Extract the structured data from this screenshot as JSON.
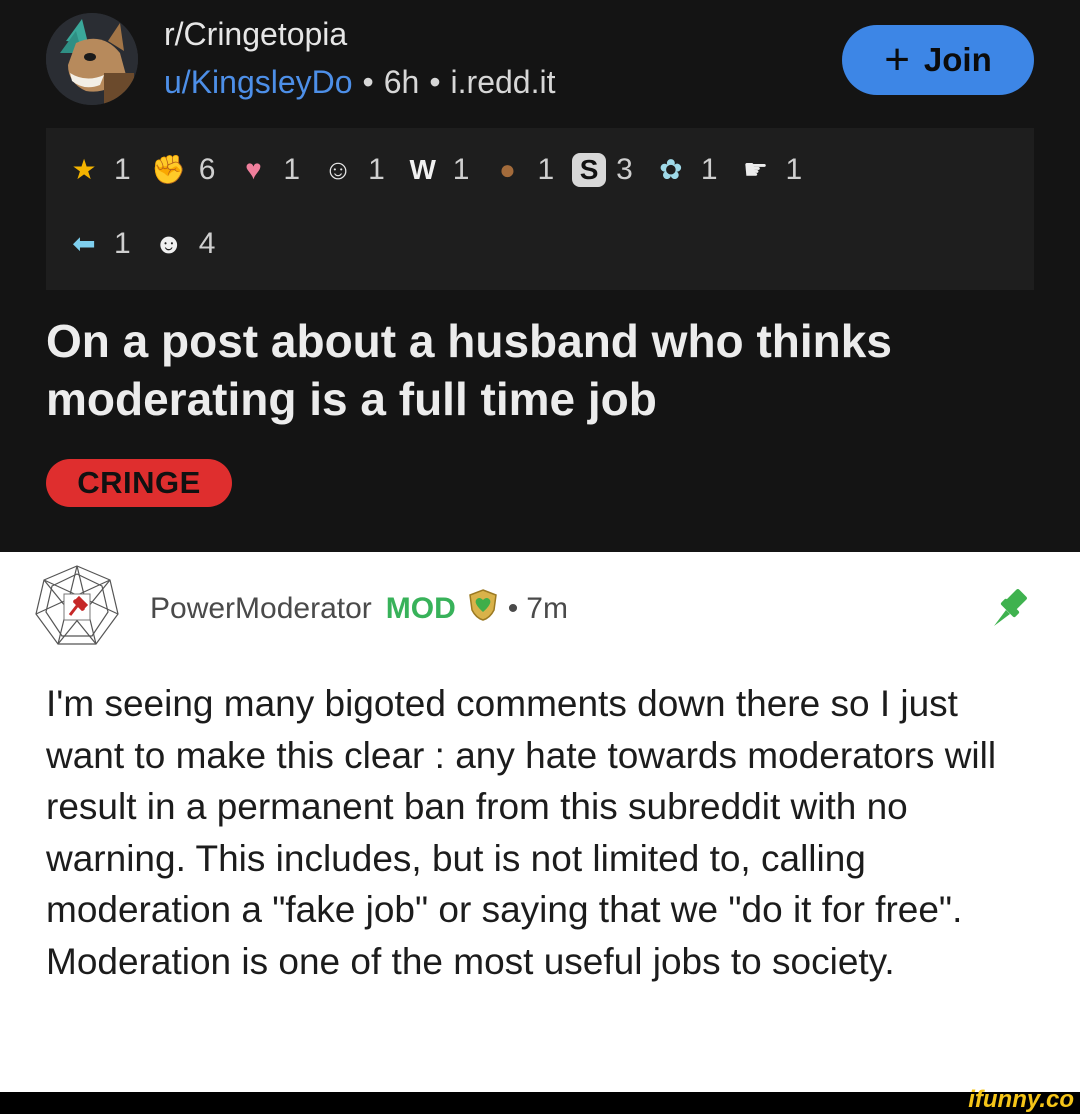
{
  "post": {
    "subreddit": "r/Cringetopia",
    "user": "u/KingsleyDo",
    "separator": "•",
    "age": "6h",
    "domain": "i.redd.it",
    "join_label": "Join",
    "join_plus": "+",
    "title": "On a post about a husband who thinks moderating is a full time job",
    "flair": "CRINGE",
    "colors": {
      "flair": "#df2e2e",
      "join": "#3d86e6",
      "user": "#4d8fe8"
    }
  },
  "awards": {
    "row1": [
      {
        "icon": "gold-star-award-icon",
        "glyph": "★",
        "count": "1"
      },
      {
        "icon": "helpful-hands-award-icon",
        "glyph": "✊",
        "count": "6"
      },
      {
        "icon": "wholesome-heart-award-icon",
        "glyph": "♥",
        "count": "1"
      },
      {
        "icon": "snoo-award-icon",
        "glyph": "☺",
        "count": "1"
      },
      {
        "icon": "bunny-ears-award-icon",
        "glyph": "W",
        "count": "1"
      },
      {
        "icon": "bear-award-icon",
        "glyph": "●",
        "count": "1"
      },
      {
        "icon": "dollar-coin-award-icon",
        "glyph": "S",
        "count": "3"
      },
      {
        "icon": "angel-award-icon",
        "glyph": "✿",
        "count": "1"
      },
      {
        "icon": "pointing-hand-award-icon",
        "glyph": "☛",
        "count": "1"
      }
    ],
    "row2": [
      {
        "icon": "arrow-award-icon",
        "glyph": "⬅",
        "count": "1"
      },
      {
        "icon": "face-award-icon",
        "glyph": "☻",
        "count": "4"
      }
    ]
  },
  "comment": {
    "author": "PowerModerator",
    "mod_label": "MOD",
    "separator": "•",
    "age": "7m",
    "body": "I'm seeing many bigoted comments down there so I just want to make this clear : any hate towards moderators will result in a permanent ban from this subreddit with no warning. This includes, but is not limited to, calling moderation a \"fake job\" or saying that we \"do it for free\". Moderation is one of the most useful jobs to society.",
    "colors": {
      "mod": "#38b25a",
      "pin": "#3fb24f"
    }
  },
  "watermark": "ifunny.co"
}
